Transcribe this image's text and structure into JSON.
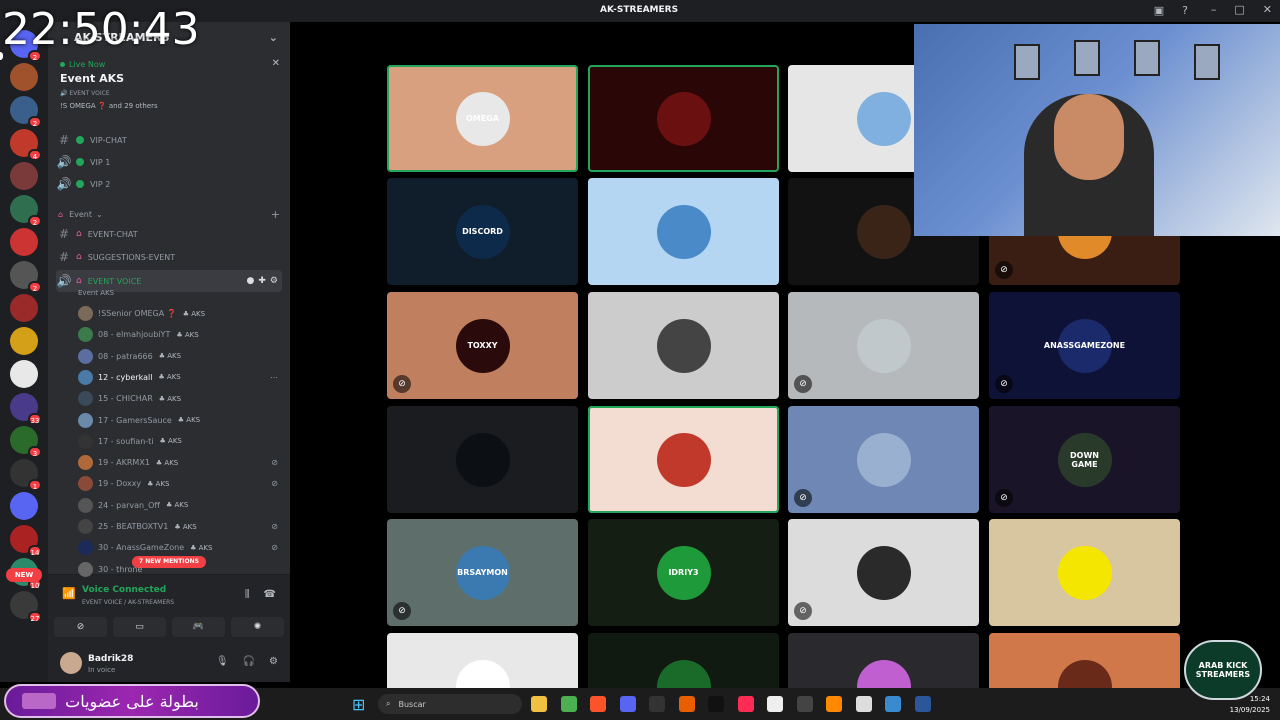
{
  "clock": "22:50:43",
  "window": {
    "title": "AK-STREAMERS"
  },
  "server": {
    "name": "AK-STREAMERS"
  },
  "event_card": {
    "live_label": "Live Now",
    "title": "Event AKS",
    "voice_label": "EVENT VOICE",
    "attendees": "!S OMEGA ❓ and 29 others"
  },
  "channels_top": [
    {
      "name": "VIP-CHAT",
      "type": "text"
    },
    {
      "name": "VIP 1",
      "type": "voice"
    },
    {
      "name": "VIP 2",
      "type": "voice"
    }
  ],
  "category": {
    "name": "Event"
  },
  "channels_event": [
    {
      "name": "EVENT-CHAT",
      "type": "text"
    },
    {
      "name": "SUGGESTIONS-EVENT",
      "type": "text"
    }
  ],
  "event_voice": {
    "name": "EVENT VOICE",
    "subtitle": "Event AKS"
  },
  "members": [
    {
      "name": "!SSenior OMEGA ❓",
      "tag": "AKS",
      "color": "#7a6a5a"
    },
    {
      "name": "08 - elmahjoubiYT",
      "tag": "AKS",
      "color": "#3b7a4b"
    },
    {
      "name": "08 - patra666",
      "tag": "AKS",
      "color": "#5a6fa0"
    },
    {
      "name": "12 - cyberkall",
      "tag": "AKS",
      "color": "#4a7aa8"
    },
    {
      "name": "15 - CHICHAR",
      "tag": "AKS",
      "color": "#3a4a5a"
    },
    {
      "name": "17 - GamersSauce",
      "tag": "AKS",
      "color": "#6a8aaa"
    },
    {
      "name": "17 - soufian-ti",
      "tag": "AKS",
      "color": "#333"
    },
    {
      "name": "19 - AKRMX1",
      "tag": "AKS",
      "color": "#b06a3a"
    },
    {
      "name": "19 - Doxxy",
      "tag": "AKS",
      "color": "#8a4a3a"
    },
    {
      "name": "24 - parvan_Off",
      "tag": "AKS",
      "color": "#555"
    },
    {
      "name": "25 - BEATBOXTV1",
      "tag": "AKS",
      "color": "#444"
    },
    {
      "name": "30 - AnassGameZone",
      "tag": "AKS",
      "color": "#1c2a5a"
    },
    {
      "name": "30 - throne",
      "tag": "",
      "color": "#666"
    }
  ],
  "mentions_badge": "7 NEW MENTIONS",
  "new_badge": "NEW",
  "voice_panel": {
    "title": "Voice Connected",
    "subtitle": "EVENT VOICE / AK-STREAMERS"
  },
  "user": {
    "name": "Badrik28",
    "status": "In voice"
  },
  "rail_badges": [
    "2",
    "",
    "2",
    "4",
    "",
    "2",
    "",
    "2",
    "",
    "",
    "",
    "33",
    "3",
    "1",
    "",
    "14",
    "10",
    "27"
  ],
  "tiles": [
    {
      "bg": "#d9a07f",
      "avatar": "#e8e8e8",
      "label": "OMEGA",
      "speaking": true,
      "muted": false
    },
    {
      "bg": "#2a0606",
      "avatar": "#6a1010",
      "label": "",
      "speaking": true,
      "muted": false
    },
    {
      "bg": "#e6e6e6",
      "avatar": "#7fb0e0",
      "label": "",
      "speaking": false,
      "muted": false
    },
    {
      "bg": "#101d2b",
      "avatar": "#0e2a4a",
      "label": "DISCORD",
      "speaking": false,
      "muted": false
    },
    {
      "bg": "#b5d6f2",
      "avatar": "#4a8ac8",
      "label": "",
      "speaking": false,
      "muted": false
    },
    {
      "bg": "#121212",
      "avatar": "#3a2418",
      "label": "",
      "speaking": false,
      "muted": false
    },
    {
      "bg": "#3a1e14",
      "avatar": "#e08a2a",
      "label": "",
      "speaking": false,
      "muted": true
    },
    {
      "bg": "#c08060",
      "avatar": "#2a0a0a",
      "label": "TOXXY",
      "speaking": false,
      "muted": true
    },
    {
      "bg": "#cccccc",
      "avatar": "#444444",
      "label": "",
      "speaking": false,
      "muted": false
    },
    {
      "bg": "#b5b9bb",
      "avatar": "#c0c8cc",
      "label": "",
      "speaking": false,
      "muted": true
    },
    {
      "bg": "#0e1236",
      "avatar": "#1a2a6a",
      "label": "ANASSGAMEZONE",
      "speaking": false,
      "muted": true
    },
    {
      "bg": "#1a1c20",
      "avatar": "#0c0f14",
      "label": "",
      "speaking": false,
      "muted": false
    },
    {
      "bg": "#f3ddd2",
      "avatar": "#c0392b",
      "label": "",
      "speaking": true,
      "muted": false
    },
    {
      "bg": "#6e87b4",
      "avatar": "#9ab0d0",
      "label": "",
      "speaking": false,
      "muted": true
    },
    {
      "bg": "#1a1428",
      "avatar": "#2a3a2a",
      "label": "DOWN GAME",
      "speaking": false,
      "muted": true
    },
    {
      "bg": "#5e6e6b",
      "avatar": "#3a7ab0",
      "label": "BRSAYMON",
      "speaking": false,
      "muted": true
    },
    {
      "bg": "#141e12",
      "avatar": "#1f9a3a",
      "label": "IDRIY3",
      "speaking": false,
      "muted": false
    },
    {
      "bg": "#dcdcdc",
      "avatar": "#2a2a2a",
      "label": "",
      "speaking": false,
      "muted": true
    },
    {
      "bg": "#d7c6a0",
      "avatar": "#f5e600",
      "label": "",
      "speaking": false,
      "muted": false
    },
    {
      "bg": "#e8e8e8",
      "avatar": "#ffffff",
      "label": "",
      "speaking": false,
      "muted": false
    },
    {
      "bg": "#101a10",
      "avatar": "#1a6a2a",
      "label": "",
      "speaking": false,
      "muted": false
    },
    {
      "bg": "#2a2a2e",
      "avatar": "#c060d0",
      "label": "",
      "speaking": false,
      "muted": false
    },
    {
      "bg": "#d0784a",
      "avatar": "#6a2a1a",
      "label": "",
      "speaking": false,
      "muted": false
    }
  ],
  "banner": {
    "text": "بطولة على عضويات"
  },
  "taskbar": {
    "search_placeholder": "Buscar",
    "time": "15:24",
    "date": "13/09/2025"
  },
  "logo": {
    "text": "ARAB KICK STREAMERS"
  }
}
